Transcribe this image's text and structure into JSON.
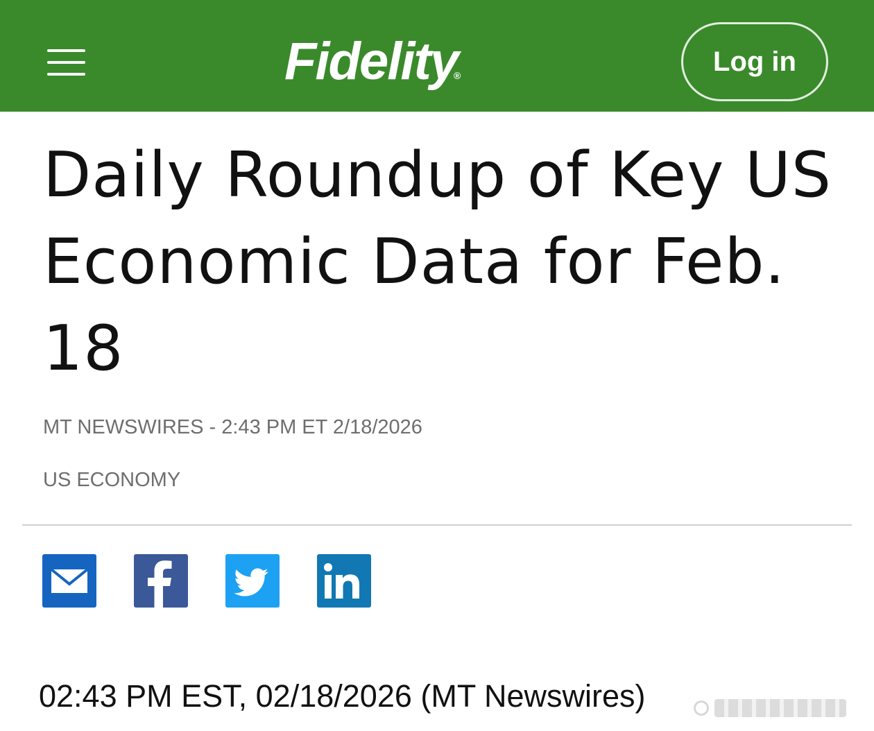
{
  "header": {
    "menu_icon": "hamburger-menu-icon",
    "brand": "Fidelity",
    "brand_mark": "®",
    "login_label": "Log in",
    "brand_color": "#3a8a2b"
  },
  "article": {
    "title": "Daily Roundup of Key US Economic Data for Feb. 18",
    "source": "MT NEWSWIRES -",
    "timestamp": "2:43 PM ET 2/18/2026",
    "category": "US ECONOMY",
    "share": [
      {
        "name": "email",
        "icon": "email-icon",
        "color": "#1565c0"
      },
      {
        "name": "facebook",
        "icon": "facebook-icon",
        "color": "#3b5998"
      },
      {
        "name": "twitter",
        "icon": "twitter-icon",
        "color": "#1da1f2"
      },
      {
        "name": "linkedin",
        "icon": "linkedin-icon",
        "color": "#1178b3"
      }
    ],
    "dateline": "02:43 PM EST, 02/18/2026 (MT Newswires)"
  }
}
